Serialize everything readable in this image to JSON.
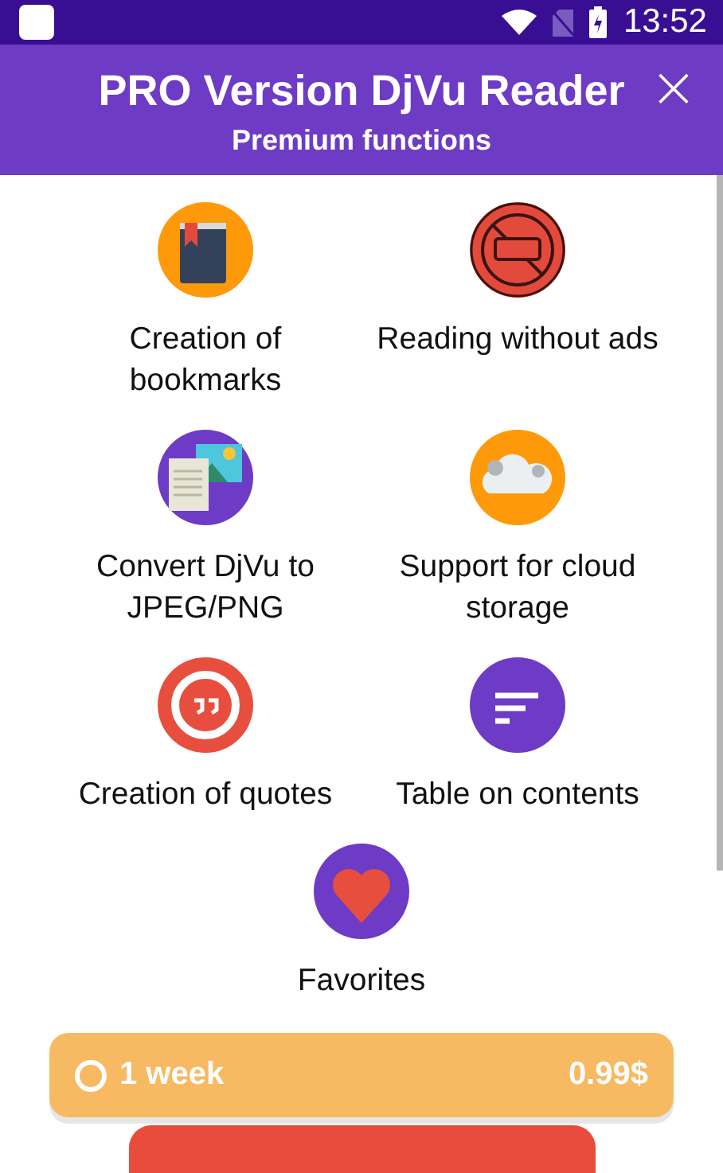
{
  "status_bar": {
    "time": "13:52"
  },
  "header": {
    "title": "PRO Version DjVu Reader",
    "subtitle": "Premium functions",
    "close": "×"
  },
  "features": [
    {
      "kind": "bookmark",
      "label": "Creation of bookmarks",
      "color": "#fe9a0a"
    },
    {
      "kind": "no-ads",
      "label": "Reading without ads",
      "color": "#e44a3c"
    },
    {
      "kind": "convert",
      "label": "Convert DjVu to JPEG/PNG",
      "color": "#6d3bc6"
    },
    {
      "kind": "cloud",
      "label": "Support for cloud storage",
      "color": "#fe9a0a"
    },
    {
      "kind": "quote",
      "label": "Creation of quotes",
      "color": "#e84e3e"
    },
    {
      "kind": "toc",
      "label": "Table on contents",
      "color": "#6d3bc6"
    },
    {
      "kind": "favorite",
      "label": "Favorites",
      "color": "#6d3bc6"
    }
  ],
  "plans": [
    {
      "label": "1 week",
      "price": "0.99$",
      "selected": false
    }
  ]
}
